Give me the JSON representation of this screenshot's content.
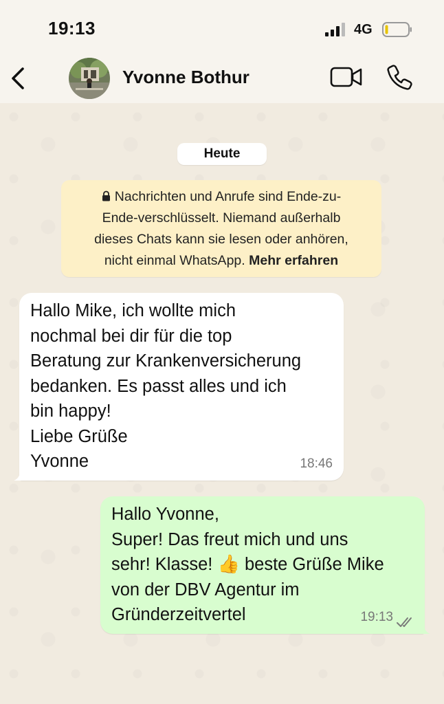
{
  "status_bar": {
    "time": "19:13",
    "network": "4G",
    "signal_icon": "cellular-signal-icon",
    "battery_icon": "battery-low-icon"
  },
  "header": {
    "back_icon": "chevron-left-icon",
    "contact_name": "Yvonne Bothur",
    "video_icon": "video-camera-icon",
    "call_icon": "phone-icon"
  },
  "chat": {
    "date_label": "Heute",
    "encryption_notice": {
      "lines": [
        "Nachrichten und Anrufe sind Ende-zu-",
        "Ende-verschlüsselt. Niemand außerhalb",
        "dieses Chats kann sie lesen oder anhören,",
        "nicht einmal WhatsApp."
      ],
      "link_label": "Mehr erfahren",
      "icon": "lock-icon"
    },
    "messages": [
      {
        "direction": "incoming",
        "lines": [
          "Hallo Mike, ich wollte mich",
          "nochmal bei dir für die top",
          "Beratung zur Krankenversicherung",
          "bedanken. Es passt alles und ich",
          "bin happy!",
          "Liebe Grüße",
          "Yvonne"
        ],
        "time": "18:46"
      },
      {
        "direction": "outgoing",
        "lines": [
          "Hallo Yvonne,",
          "Super! Das freut mich und uns",
          "sehr! Klasse!",
          "beste Grüße Mike",
          "von der DBV Agentur im",
          "Gründerzeitvertel"
        ],
        "emoji": "👍",
        "time": "19:13",
        "status_icon": "double-check-read-icon"
      }
    ]
  },
  "colors": {
    "chat_background": "#f1ebe0",
    "incoming_bubble": "#ffffff",
    "outgoing_bubble": "#d8fdcf",
    "notice_background": "#fdf0c7"
  }
}
